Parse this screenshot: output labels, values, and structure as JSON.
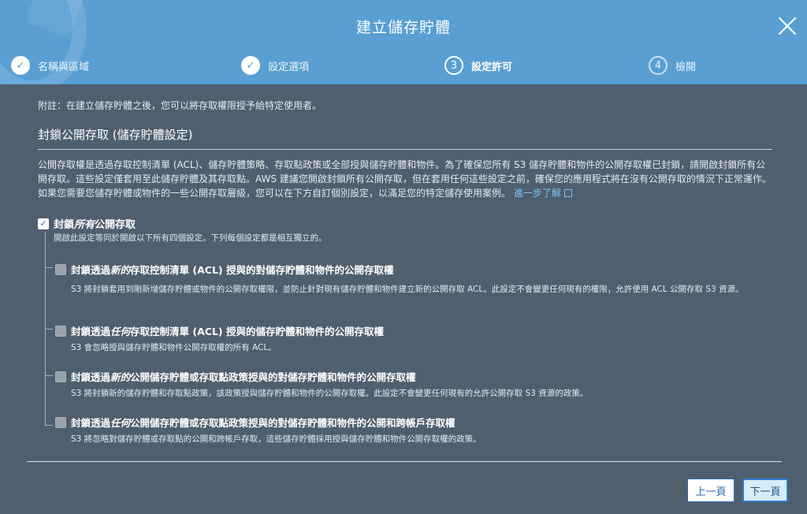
{
  "dialog": {
    "title": "建立儲存貯體"
  },
  "steps": [
    {
      "number": "1",
      "label": "名稱與區域",
      "state": "done"
    },
    {
      "number": "2",
      "label": "設定選項",
      "state": "done"
    },
    {
      "number": "3",
      "label": "設定許可",
      "state": "current"
    },
    {
      "number": "4",
      "label": "檢閱",
      "state": "pending"
    }
  ],
  "note": "附註：在建立儲存貯體之後，您可以將存取權限授予給特定使用者。",
  "section": {
    "title": "封鎖公開存取 (儲存貯體設定)",
    "description": "公開存取權是透過存取控制清單 (ACL)、儲存貯體策略、存取點政策或全部授與儲存貯體和物件。為了確保您所有 S3 儲存貯體和物件的公開存取權已封鎖，請開啟封鎖所有公開存取。這些設定僅套用至此儲存貯體及其存取點。AWS 建議您開啟封鎖所有公開存取，但在套用任何這些設定之前，確保您的應用程式將在沒有公開存取的情況下正常運作。如果您需要您儲存貯體或物件的一些公開存取層級，您可以在下方自訂個別設定，以滿足您的特定儲存使用案例。",
    "learn_more": "進一步了解"
  },
  "block_all": {
    "checked": true,
    "label_pre": "封鎖",
    "label_em": "所有",
    "label_post": "公開存取",
    "sub": "開啟此設定等同於開啟以下所有四個設定。下列每個設定都是相互獨立的。"
  },
  "options": [
    {
      "label_pre": "封鎖透過",
      "label_em": "新的",
      "label_post": "存取控制清單 (ACL) 授與的對儲存貯體和物件的公開存取權",
      "sub": "S3 將封鎖套用到剛新增儲存貯體或物件的公開存取權限，並防止針對現有儲存貯體和物件建立新的公開存取 ACL。此設定不會變更任何現有的權限，允許使用 ACL 公開存取 S3 資源。"
    },
    {
      "label_pre": "封鎖透過",
      "label_em": "任何",
      "label_post": "存取控制清單 (ACL) 授與的儲存貯體和物件的公開存取權",
      "sub": "S3 會忽略授與儲存貯體和物件公開存取權的所有 ACL。"
    },
    {
      "label_pre": "封鎖透過",
      "label_em": "新的",
      "label_post": "公開儲存貯體或存取點政策授與的對儲存貯體和物件的公開存取權",
      "sub": "S3 將封鎖新的儲存貯體和存取點政策，該政策授與儲存貯體和物件的公開存取權。此設定不會變更任何現有的允許公開存取 S3 資源的政策。"
    },
    {
      "label_pre": "封鎖透過",
      "label_em": "任何",
      "label_post": "公開儲存貯體或存取點政策授與的對儲存貯體和物件的公開和跨帳戶存取權",
      "sub": "S3 將忽略對儲存貯體或存取點的公開和跨帳戶存取，這些儲存貯體採用授與儲存貯體和物件公開存取權的政策。"
    }
  ],
  "buttons": {
    "prev": "上一頁",
    "next": "下一頁"
  },
  "colors": {
    "header": "#5a9fd4",
    "body": "#4f5f6e",
    "link": "#7fc4f4",
    "primary_border": "#2e7dd2"
  }
}
